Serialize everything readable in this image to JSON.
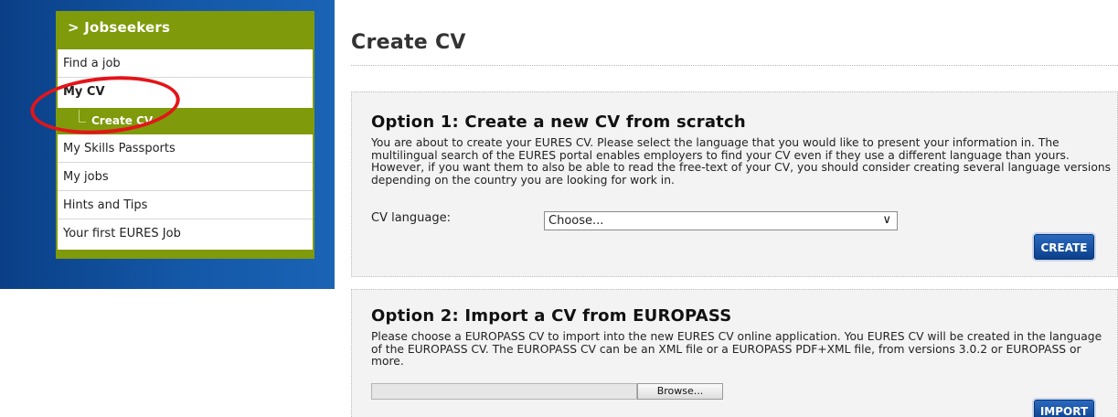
{
  "sidebar": {
    "heading": "> Jobseekers",
    "items": [
      {
        "label": "Find a job"
      },
      {
        "label": "My CV"
      },
      {
        "label": "Create CV"
      },
      {
        "label": "My Skills Passports"
      },
      {
        "label": "My jobs"
      },
      {
        "label": "Hints and Tips"
      },
      {
        "label": "Your first EURES Job"
      }
    ]
  },
  "main": {
    "title": "Create CV",
    "option1": {
      "title": "Option 1: Create a new CV from scratch",
      "text": "You are about to create your EURES CV. Please select the language that you would like to present your information in. The multilingual search of the EURES portal enables employers to find your CV even if they use a different language than yours. However, if you want them to also be able to read the free-text of your CV, you should consider creating several language versions depending on the country you are looking for work in.",
      "language_label": "CV language:",
      "language_value": "Choose...",
      "button": "CREATE"
    },
    "option2": {
      "title": "Option 2: Import a CV from EUROPASS",
      "text": "Please choose a EUROPASS CV to import into the new EURES CV online application. You EURES CV will be created in the language of the EUROPASS CV. The EUROPASS CV can be an XML file or a EUROPASS PDF+XML file, from versions 3.0.2 or EUROPASS or more.",
      "browse": "Browse...",
      "button": "IMPORT"
    }
  },
  "colors": {
    "sidebar_green": "#7f9a0a",
    "sidebar_blue": "#1458a8",
    "button_blue": "#0b3f8a",
    "annotation_red": "#e3151a"
  }
}
